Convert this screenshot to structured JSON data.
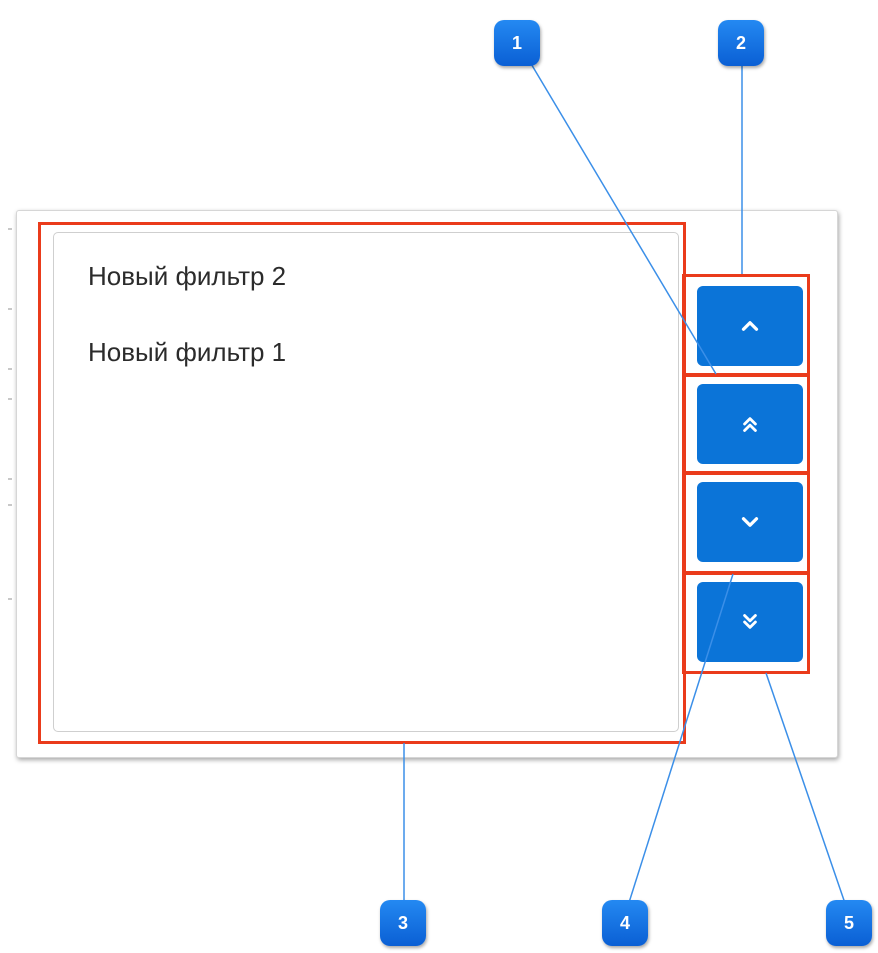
{
  "list": {
    "items": [
      {
        "label": "Новый фильтр 2"
      },
      {
        "label": "Новый фильтр 1"
      }
    ]
  },
  "buttons": [
    {
      "icon": "chevron-up-icon"
    },
    {
      "icon": "double-chevron-up-icon"
    },
    {
      "icon": "chevron-down-icon"
    },
    {
      "icon": "double-chevron-down-icon"
    }
  ],
  "callouts": [
    "1",
    "2",
    "3",
    "4",
    "5"
  ],
  "colors": {
    "button": "#0b74d8",
    "highlight": "#ea3b1b",
    "callout": "#1677ee",
    "callout_line": "#3b8fe8"
  }
}
